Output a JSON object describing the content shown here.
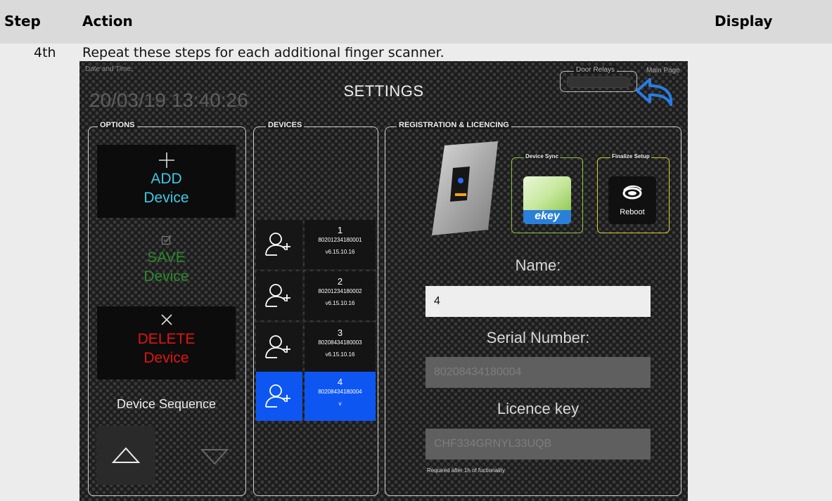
{
  "table": {
    "headers": {
      "step": "Step",
      "action": "Action",
      "display": "Display"
    },
    "row": {
      "step": "4th",
      "action": "Repeat these steps for each additional finger scanner."
    }
  },
  "screen": {
    "date_label": "Date and Time:",
    "date_value": "20/03/19 13:40:26",
    "title": "SETTINGS",
    "door_relays_label": "Door Relays",
    "main_page_label": "Main Page",
    "options": {
      "label": "OPTIONS",
      "add": {
        "line1": "ADD",
        "line2": "Device"
      },
      "save": {
        "line1": "SAVE",
        "line2": "Device"
      },
      "delete": {
        "line1": "DELETE",
        "line2": "Device"
      },
      "sequence_label": "Device Sequence"
    },
    "devices": {
      "label": "DEVICES",
      "items": [
        {
          "number": "1",
          "serial": "80201234180001",
          "version": "v6.15.10.16"
        },
        {
          "number": "2",
          "serial": "80201234180002",
          "version": "v6.15.10.16"
        },
        {
          "number": "3",
          "serial": "80208434180003",
          "version": "v6.15.10.16"
        },
        {
          "number": "4",
          "serial": "80208434180004",
          "version": "v"
        }
      ]
    },
    "registration": {
      "label": "REGISTRATION & LICENCING",
      "device_sync_label": "Device Sync",
      "ekey_text": "ekey",
      "finalize_label": "Finalize Setup",
      "reboot_label": "Reboot",
      "name_label": "Name:",
      "name_value": "4",
      "serial_label": "Serial Number:",
      "serial_value": "80208434180004",
      "licence_label": "Licence key",
      "licence_value": "CHF334GRNYL33UQB",
      "note": "Required after 1h of fuctionality"
    }
  },
  "colors": {
    "add": "#3ec9e6",
    "save": "#2c8a2c",
    "delete": "#e01414",
    "selected_device": "#0d56f2",
    "back_arrow": "#2a7de1",
    "device_sync_border": "#8cc33f",
    "finalize_border": "#d6cc2c"
  }
}
